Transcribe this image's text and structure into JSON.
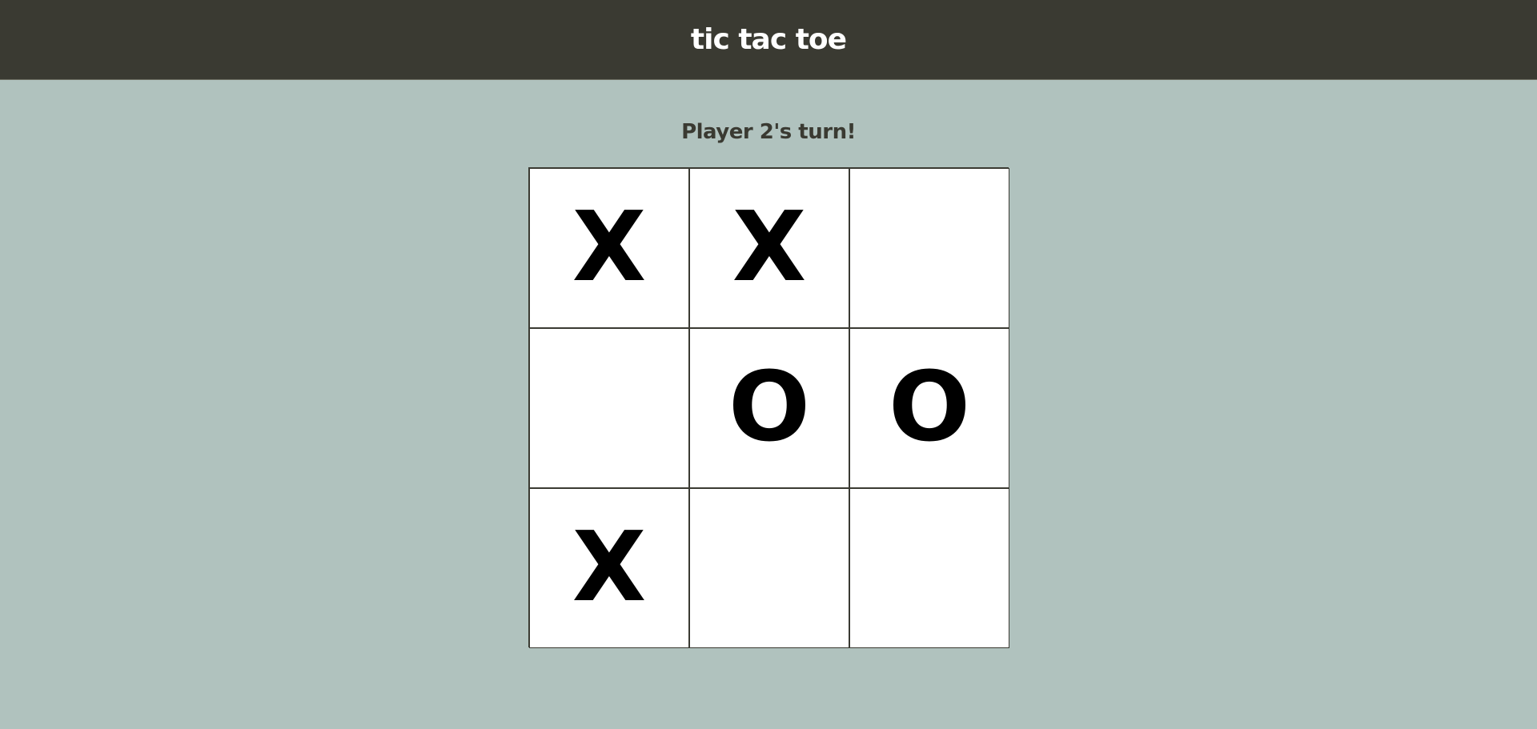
{
  "header": {
    "title": "tic tac toe"
  },
  "game": {
    "status": "Player 2's turn!",
    "board": [
      [
        "X",
        "X",
        ""
      ],
      [
        "",
        "O",
        "O"
      ],
      [
        "X",
        "",
        ""
      ]
    ]
  },
  "colors": {
    "header_bg": "#3a3a32",
    "page_bg": "#b0c2be",
    "cell_bg": "#ffffff",
    "grid_line": "#3a3a32",
    "mark": "#000000"
  }
}
